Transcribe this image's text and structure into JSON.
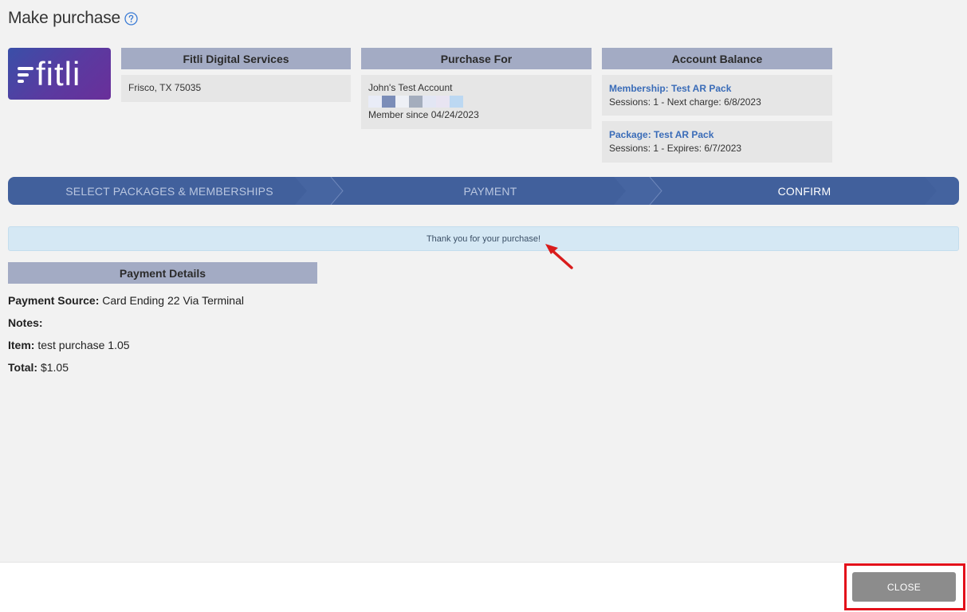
{
  "header": {
    "title": "Make purchase",
    "help_icon": "question-circle-icon"
  },
  "logo": {
    "text": "fitli"
  },
  "colors": {
    "card_header": "#a3abc4",
    "step_bar": "#41609c",
    "alert_bg": "#d5e8f4",
    "link": "#3a6cb8",
    "close_button": "#8c8c8c",
    "highlight": "#e3101a"
  },
  "cards": {
    "vendor": {
      "title": "Fitli Digital Services",
      "address": "Frisco, TX 75035"
    },
    "purchase_for": {
      "title": "Purchase For",
      "account_name": "John's Test Account",
      "member_since": "Member since 04/24/2023",
      "swatch_colors": [
        "#e9ecf7",
        "#7b8db8",
        "#eef0f6",
        "#a4adbd",
        "#e2e6f4",
        "#e8e4f2",
        "#bcd8f2"
      ]
    },
    "account_balance": {
      "title": "Account Balance",
      "items": [
        {
          "title": "Membership: Test AR Pack",
          "detail": "Sessions: 1 -  Next charge: 6/8/2023"
        },
        {
          "title": "Package: Test AR Pack",
          "detail": "Sessions: 1 -  Expires: 6/7/2023"
        }
      ]
    }
  },
  "steps": [
    {
      "label": "SELECT PACKAGES & MEMBERSHIPS",
      "active": false
    },
    {
      "label": "PAYMENT",
      "active": false
    },
    {
      "label": "CONFIRM",
      "active": true
    }
  ],
  "alert": {
    "message": "Thank you for your purchase!",
    "annotation_icon": "red-arrow-icon"
  },
  "payment_details": {
    "title": "Payment Details",
    "rows": [
      {
        "label": "Payment Source:",
        "value": "Card Ending 22 Via Terminal"
      },
      {
        "label": "Notes:",
        "value": ""
      },
      {
        "label": "Item:",
        "value": "test purchase 1.05"
      },
      {
        "label": "Total:",
        "value": "$1.05"
      }
    ]
  },
  "footer": {
    "close_label": "CLOSE"
  }
}
